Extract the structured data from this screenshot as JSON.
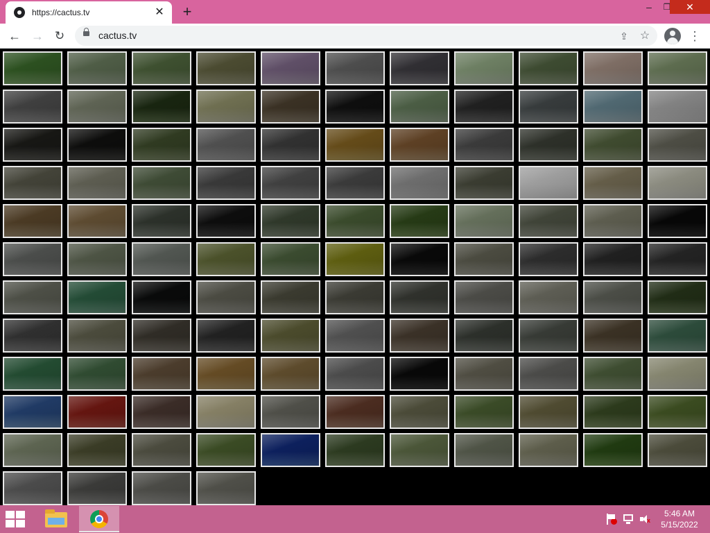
{
  "browser": {
    "tab_title": "https://cactus.tv",
    "tab_close_glyph": "✕",
    "new_tab_glyph": "+",
    "window_controls": {
      "minimize": "–",
      "maximize": "❐",
      "close": "✕"
    },
    "url": "cactus.tv",
    "nav": {
      "back": "←",
      "forward": "→",
      "reload": "↻"
    },
    "share_glyph": "⇪",
    "star_glyph": "☆",
    "menu_glyph": "⋮"
  },
  "grid": {
    "columns": 11,
    "cameras": [
      "#6a8f5a",
      "#8e9a86",
      "#7e8f6f",
      "#8a8a70",
      "#9c8ea2",
      "#8c8c8c",
      "#6f6d72",
      "#a7b49f",
      "#7d8a70",
      "#b3a7a0",
      "#9aa68e",
      "#7f7f7f",
      "#9b9f92",
      "#4f6140",
      "#a8a890",
      "#7a7060",
      "#3c3c3c",
      "#8a9a84",
      "#5a5a5a",
      "#767b7c",
      "#8fa3aa",
      "#b6b6b6",
      "#4c4c48",
      "#3a3a38",
      "#6e7a5c",
      "#8e8e8e",
      "#707070",
      "#a08a50",
      "#9a8060",
      "#7a7a7a",
      "#6b6f66",
      "#7f8a6e",
      "#8c8c84",
      "#838378",
      "#9a9a90",
      "#7e8a74",
      "#787878",
      "#808080",
      "#7a7a7a",
      "#a7a7a7",
      "#7a7c70",
      "#c8c8c8",
      "#a09a88",
      "#bcbcb4",
      "#8a7a60",
      "#9a8a70",
      "#6a7068",
      "#3a3a3a",
      "#6e7868",
      "#7a8a6a",
      "#627a4a",
      "#a0a898",
      "#808478",
      "#9a9a8e",
      "#2a2a2a",
      "#8a8c8a",
      "#8c9284",
      "#909490",
      "#8a9068",
      "#7a8a6e",
      "#9a9a40",
      "#303030",
      "#8a8a80",
      "#6a6a6a",
      "#5a5a5a",
      "#5e5e5e",
      "#8c8e86",
      "#5e8a74",
      "#303232",
      "#8a8a82",
      "#7a7a6e",
      "#7a7a72",
      "#6e706a",
      "#8a8a86",
      "#9a9a92",
      "#8a8c86",
      "#5a6a4a",
      "#6e6e6e",
      "#8a8a7c",
      "#6e6a62",
      "#5c5c5c",
      "#8a8a6a",
      "#8e8e8e",
      "#7a7064",
      "#6a6e68",
      "#767a74",
      "#7a7060",
      "#6a8a7a",
      "#5e8a70",
      "#6e8a70",
      "#8a7c6a",
      "#a08a60",
      "#9a8a6a",
      "#8a8a8a",
      "#2e2e2e",
      "#8e8c82",
      "#8a8a88",
      "#7e8c70",
      "#b8b8a8",
      "#5a7aa0",
      "#a04a40",
      "#7a6a64",
      "#b8b4a0",
      "#8e8e88",
      "#8a6a5a",
      "#8a8a78",
      "#7a8a64",
      "#8e8a70",
      "#6a7a54",
      "#7a8a5a",
      "#9aa090",
      "#7a7c62",
      "#8a8a7e",
      "#7a8a60",
      "#3a5a9a",
      "#6a7a5a",
      "#8a9478",
      "#8e9286",
      "#9a9a8a",
      "#5a7a42",
      "#8a8a7a",
      "#8a8a8a",
      "#7a7a78",
      "#8a8a86",
      "#8e8e88"
    ]
  },
  "taskbar": {
    "time": "5:46 AM",
    "date": "5/15/2022"
  }
}
